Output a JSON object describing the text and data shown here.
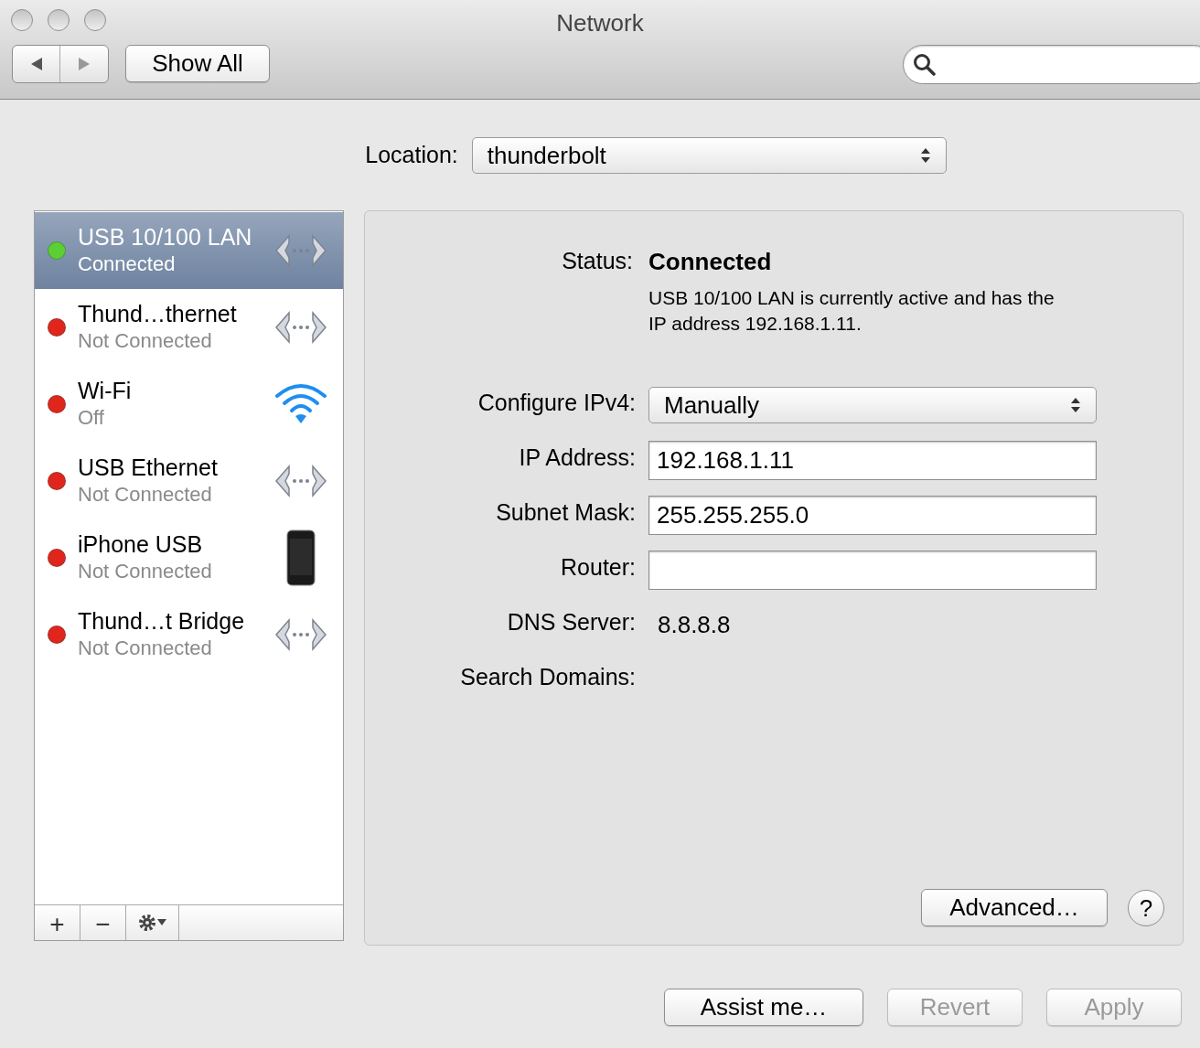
{
  "window": {
    "title": "Network"
  },
  "toolbar": {
    "show_all": "Show All"
  },
  "location": {
    "label": "Location:",
    "value": "thunderbolt"
  },
  "services": [
    {
      "name": "USB 10/100 LAN",
      "status": "Connected",
      "selected": true,
      "color": "#5ccf35",
      "kind": "ethernet"
    },
    {
      "name": "Thund…thernet",
      "status": "Not Connected",
      "selected": false,
      "color": "#e0261c",
      "kind": "ethernet"
    },
    {
      "name": "Wi-Fi",
      "status": "Off",
      "selected": false,
      "color": "#e0261c",
      "kind": "wifi"
    },
    {
      "name": "USB Ethernet",
      "status": "Not Connected",
      "selected": false,
      "color": "#e0261c",
      "kind": "ethernet"
    },
    {
      "name": "iPhone USB",
      "status": "Not Connected",
      "selected": false,
      "color": "#e0261c",
      "kind": "phone"
    },
    {
      "name": "Thund…t Bridge",
      "status": "Not Connected",
      "selected": false,
      "color": "#e0261c",
      "kind": "ethernet"
    }
  ],
  "list_controls": [
    "+",
    "−"
  ],
  "detail": {
    "status_label": "Status:",
    "status_value": "Connected",
    "description": "USB 10/100 LAN is currently active and has the IP address 192.168.1.11.",
    "fields": [
      {
        "kind": "select",
        "label": "Configure IPv4:",
        "value": "Manually"
      },
      {
        "kind": "input",
        "label": "IP Address:",
        "value": "192.168.1.11"
      },
      {
        "kind": "input",
        "label": "Subnet Mask:",
        "value": "255.255.255.0"
      },
      {
        "kind": "input",
        "label": "Router:"
      },
      {
        "kind": "text",
        "label": "DNS Server:",
        "value": "8.8.8.8"
      },
      {
        "kind": "text",
        "label": "Search Domains:"
      }
    ],
    "advanced": "Advanced…",
    "help": "?"
  },
  "buttons": [
    {
      "label": "Assist me…",
      "disabled": false
    },
    {
      "label": "Revert",
      "disabled": true
    },
    {
      "label": "Apply",
      "disabled": true
    }
  ]
}
